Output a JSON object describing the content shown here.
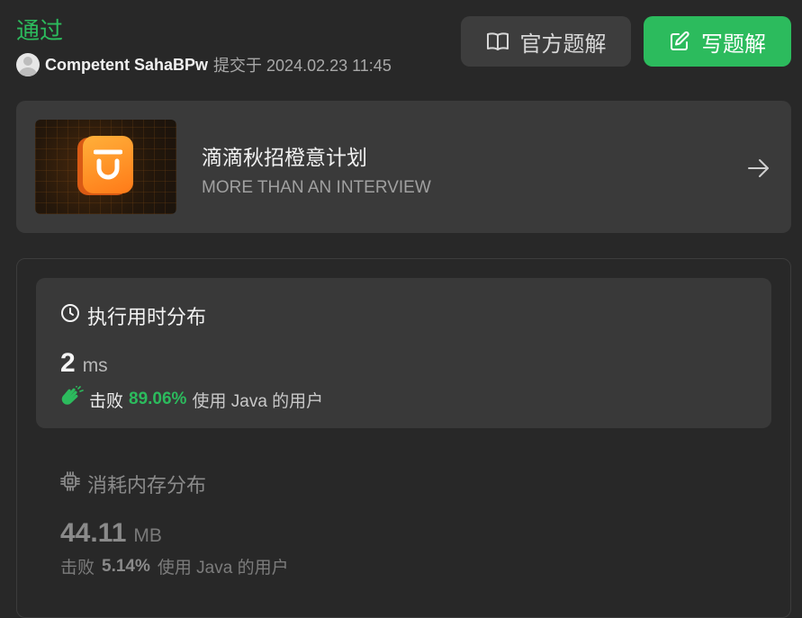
{
  "header": {
    "status": "通过",
    "username": "Competent SahaBPw",
    "submitted_text": "提交于 2024.02.23 11:45",
    "official_solution_label": "官方题解",
    "write_solution_label": "写题解",
    "colors": {
      "accent": "#2cbb5d",
      "background": "#282828"
    }
  },
  "banner": {
    "title": "滴滴秋招橙意计划",
    "subtitle": "MORE THAN AN INTERVIEW",
    "icons": [
      "didi-logo-icon",
      "arrow-right-icon"
    ]
  },
  "runtime": {
    "title": "执行用时分布",
    "value": "2",
    "unit": "ms",
    "beats_label": "击败",
    "percentile": "89.06%",
    "suffix": "使用 Java 的用户",
    "icons": [
      "clock-icon",
      "clap-icon"
    ]
  },
  "memory": {
    "title": "消耗内存分布",
    "value": "44.11",
    "unit": "MB",
    "beats_label": "击败",
    "percentile": "5.14%",
    "suffix": "使用 Java 的用户",
    "icons": [
      "chip-icon"
    ]
  }
}
